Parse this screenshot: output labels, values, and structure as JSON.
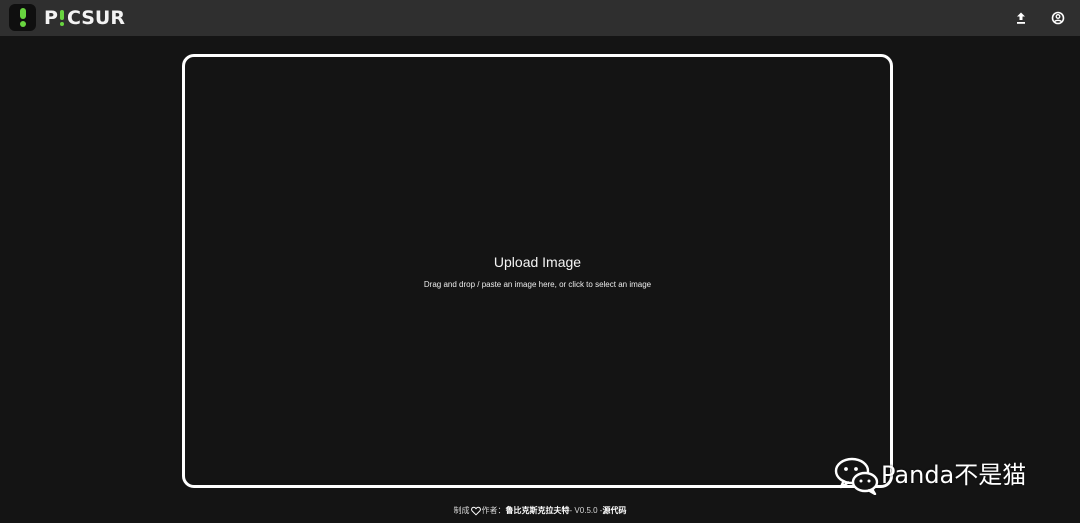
{
  "app": {
    "name": "PICSUR",
    "name_parts": [
      "P",
      "CSUR"
    ]
  },
  "header": {
    "upload_icon": "upload-icon",
    "account_icon": "account-circle-icon"
  },
  "upload_area": {
    "title": "Upload Image",
    "subtitle": "Drag and drop / paste an image here, or click to select an image",
    "border_color": "#ffffff"
  },
  "footer": {
    "made_with": "制成",
    "heart_icon": "heart-outline-icon",
    "author_label": "作者：",
    "author_name": "鲁比克斯克拉夫特",
    "version": "- V0.5.0 -",
    "source_link": "源代码"
  },
  "watermark": {
    "text": "Panda不是猫",
    "icon": "wechat-icon"
  },
  "colors": {
    "background": "#141414",
    "topbar": "#2f2f2f",
    "logo_accent": "#68d43f",
    "text": "#ffffff"
  }
}
